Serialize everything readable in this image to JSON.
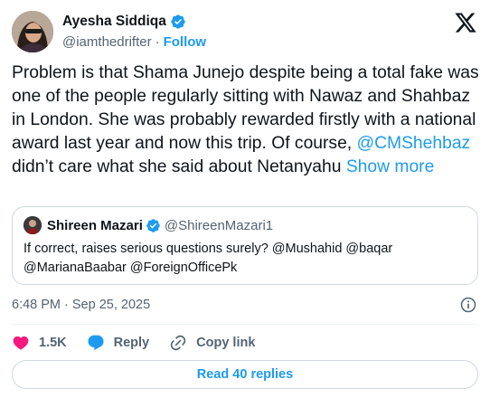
{
  "author": {
    "display_name": "Ayesha Siddiqa",
    "handle": "@iamthedrifter",
    "separator": "·",
    "follow_label": "Follow"
  },
  "tweet": {
    "text_part1": "Problem is that Shama Junejo despite being a total fake was one of the people regularly sitting with Nawaz and Shahbaz in London. She was probably rewarded firstly with a national award last year and now this trip. Of course, ",
    "mention": "@CMShehbaz",
    "text_part2": " didn’t care what she said about Netanyahu",
    "show_more_label": "Show more"
  },
  "quote": {
    "display_name": "Shireen Mazari",
    "handle": "@ShireenMazari1",
    "text": "If correct, raises serious questions surely? @Mushahid @baqar @MarianaBaabar @ForeignOfficePk"
  },
  "timestamp": "6:48 PM · Sep 25, 2025",
  "actions": {
    "like_count": "1.5K",
    "reply_label": "Reply",
    "copy_link_label": "Copy link"
  },
  "read_replies_label": "Read 40 replies",
  "colors": {
    "accent": "#1d9bf0",
    "like": "#f91880",
    "text": "#0f1419",
    "secondary": "#536471",
    "border": "#cfd9de"
  },
  "icons": [
    "verified-badge-icon",
    "x-logo-icon",
    "info-icon",
    "heart-icon",
    "reply-icon",
    "link-icon"
  ]
}
